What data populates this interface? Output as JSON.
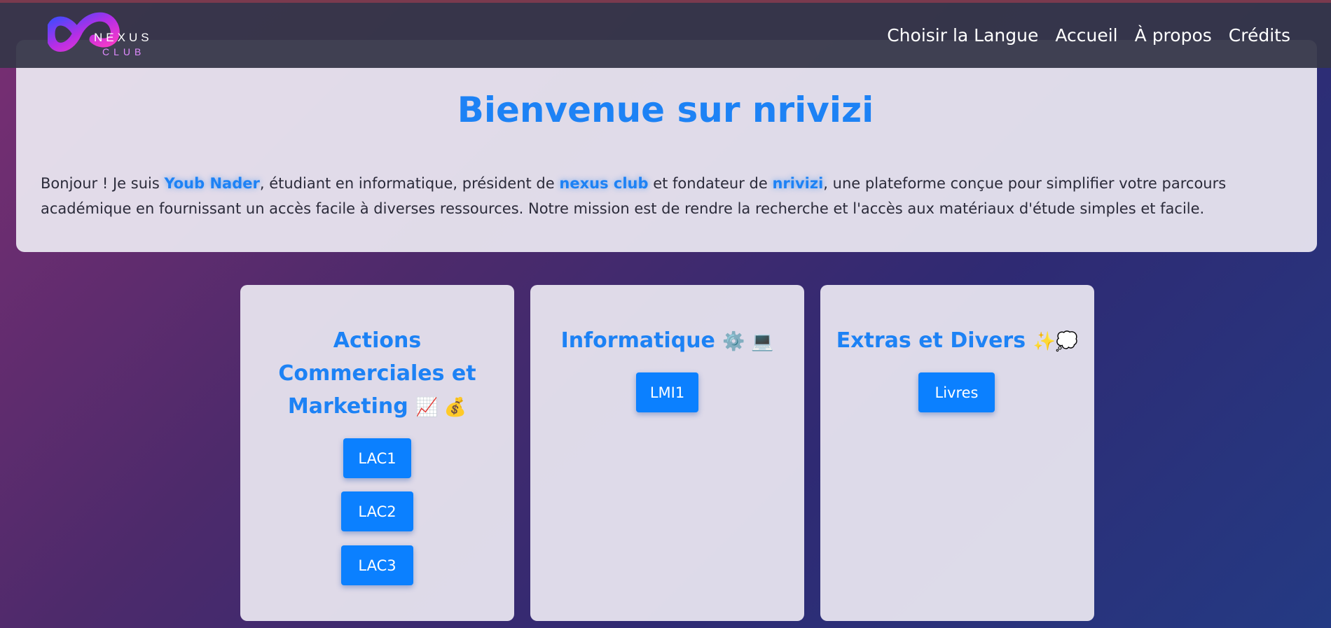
{
  "header": {
    "logo": {
      "name": "NEXUS",
      "subtitle": "CLUB"
    },
    "nav": [
      {
        "label": "Choisir la Langue"
      },
      {
        "label": "Accueil"
      },
      {
        "label": "À propos"
      },
      {
        "label": "Crédits"
      }
    ]
  },
  "hero": {
    "title": "Bienvenue sur nrivizi",
    "intro": {
      "part1": "Bonjour ! Je suis ",
      "name": "Youb Nader",
      "part2": ", étudiant en informatique, président de ",
      "club": "nexus club",
      "part3": " et fondateur de ",
      "platform": "nrivizi",
      "part4": ", une plateforme conçue pour simplifier votre parcours académique en fournissant un accès facile à diverses ressources. Notre mission est de rendre la recherche et l'accès aux matériaux d'étude simples et facile."
    }
  },
  "categories": [
    {
      "title": "Actions Commerciales et Marketing",
      "emoji": "📈 💰",
      "buttons": [
        "LAC1",
        "LAC2",
        "LAC3"
      ]
    },
    {
      "title": "Informatique",
      "emoji": "⚙️ 💻",
      "buttons": [
        "LMI1"
      ]
    },
    {
      "title": "Extras et Divers",
      "emoji": "✨💭",
      "buttons": [
        "Livres"
      ]
    }
  ],
  "colors": {
    "accent": "#1d82f5",
    "button": "#0b80ff",
    "header_bg": "#353648",
    "panel_bg": "#ece8f2"
  }
}
